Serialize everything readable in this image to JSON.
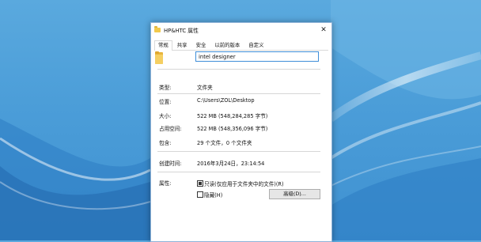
{
  "window": {
    "title": "HP&HTC 属性",
    "close_glyph": "✕"
  },
  "tabs": [
    {
      "label": "常规",
      "active": true
    },
    {
      "label": "共享"
    },
    {
      "label": "安全"
    },
    {
      "label": "以前的版本"
    },
    {
      "label": "自定义"
    }
  ],
  "name_field": {
    "value": "intel designer"
  },
  "props": {
    "type": {
      "label": "类型:",
      "value": "文件夹"
    },
    "location": {
      "label": "位置:",
      "value": "C:\\Users\\ZOL\\Desktop"
    },
    "size": {
      "label": "大小:",
      "value": "522 MB (548,284,285 字节)"
    },
    "size_on_disk": {
      "label": "占用空间:",
      "value": "522 MB (548,356,096 字节)"
    },
    "contains": {
      "label": "包含:",
      "value": "29 个文件，0 个文件夹"
    },
    "created": {
      "label": "创建时间:",
      "value": "2016年3月24日，23:14:54"
    },
    "attributes": {
      "label": "属性:"
    }
  },
  "attributes": {
    "readonly_label": "只读(仅应用于文件夹中的文件)(R)",
    "readonly_checked": true,
    "hidden_label": "隐藏(H)",
    "hidden_checked": false,
    "advanced_button": "高级(D)..."
  },
  "icons": {
    "folder": "folder-icon",
    "title_folder": "folder-icon",
    "close": "close-icon"
  },
  "colors": {
    "desktop_bg": "#4b9dd8",
    "input_border": "#3f8ed8",
    "folder": "#f2c94c"
  }
}
